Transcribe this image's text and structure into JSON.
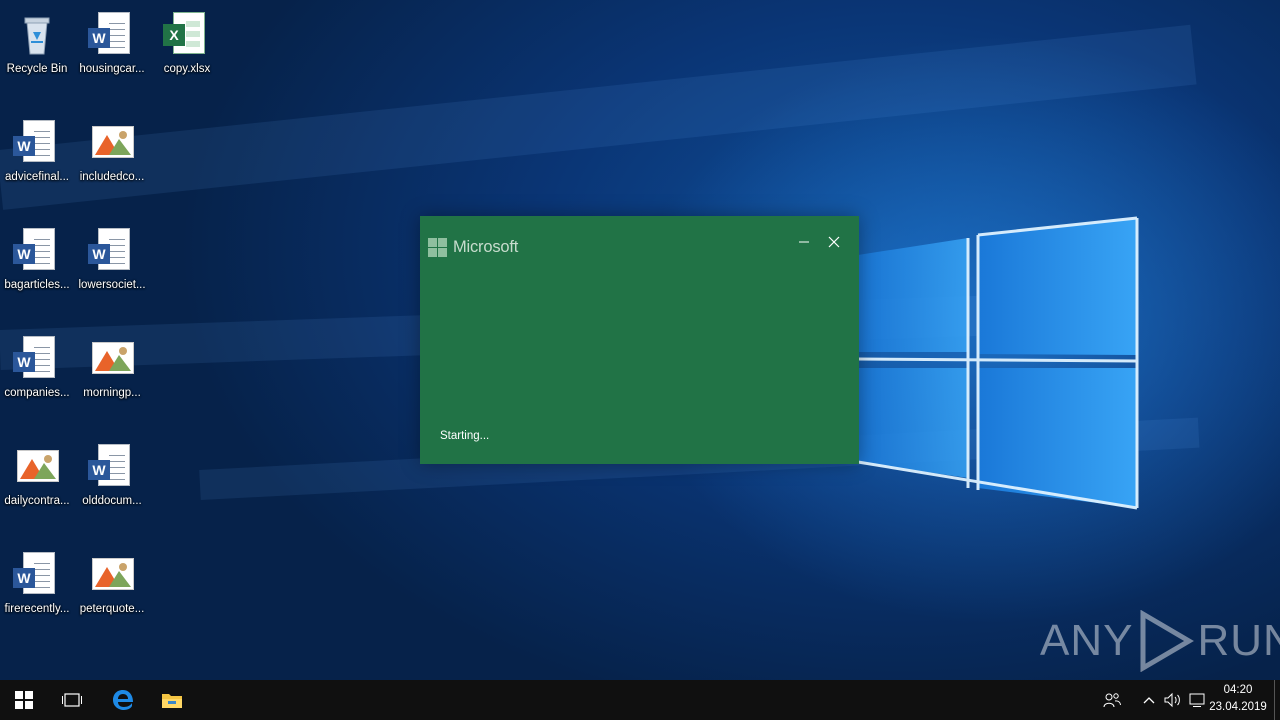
{
  "desktop": {
    "icons": [
      {
        "label": "Recycle Bin",
        "icon": "recycle-bin-icon"
      },
      {
        "label": "housingcar...",
        "icon": "word-document-icon"
      },
      {
        "label": "copy.xlsx",
        "icon": "excel-document-icon"
      },
      {
        "label": "advicefinal...",
        "icon": "word-document-icon"
      },
      {
        "label": "includedco...",
        "icon": "image-file-icon"
      },
      {
        "label": "bagarticles...",
        "icon": "word-document-icon"
      },
      {
        "label": "lowersociet...",
        "icon": "word-document-icon"
      },
      {
        "label": "companies...",
        "icon": "word-document-icon"
      },
      {
        "label": "morningp...",
        "icon": "image-file-icon"
      },
      {
        "label": "dailycontra...",
        "icon": "image-file-icon"
      },
      {
        "label": "olddocum...",
        "icon": "word-document-icon"
      },
      {
        "label": "firerecently...",
        "icon": "word-document-icon"
      },
      {
        "label": "peterquote...",
        "icon": "image-file-icon"
      }
    ]
  },
  "splash": {
    "brand": "Microsoft",
    "status": "Starting...",
    "color": "#217346"
  },
  "watermark": {
    "left": "ANY",
    "right": "RUN"
  },
  "taskbar": {
    "buttons": [
      "start-icon",
      "task-view-icon",
      "edge-icon",
      "file-explorer-icon"
    ],
    "tray": [
      "people-icon",
      "chevron-up-icon",
      "volume-icon",
      "action-center-icon"
    ],
    "clock": {
      "time": "04:20",
      "date": "23.04.2019"
    }
  }
}
